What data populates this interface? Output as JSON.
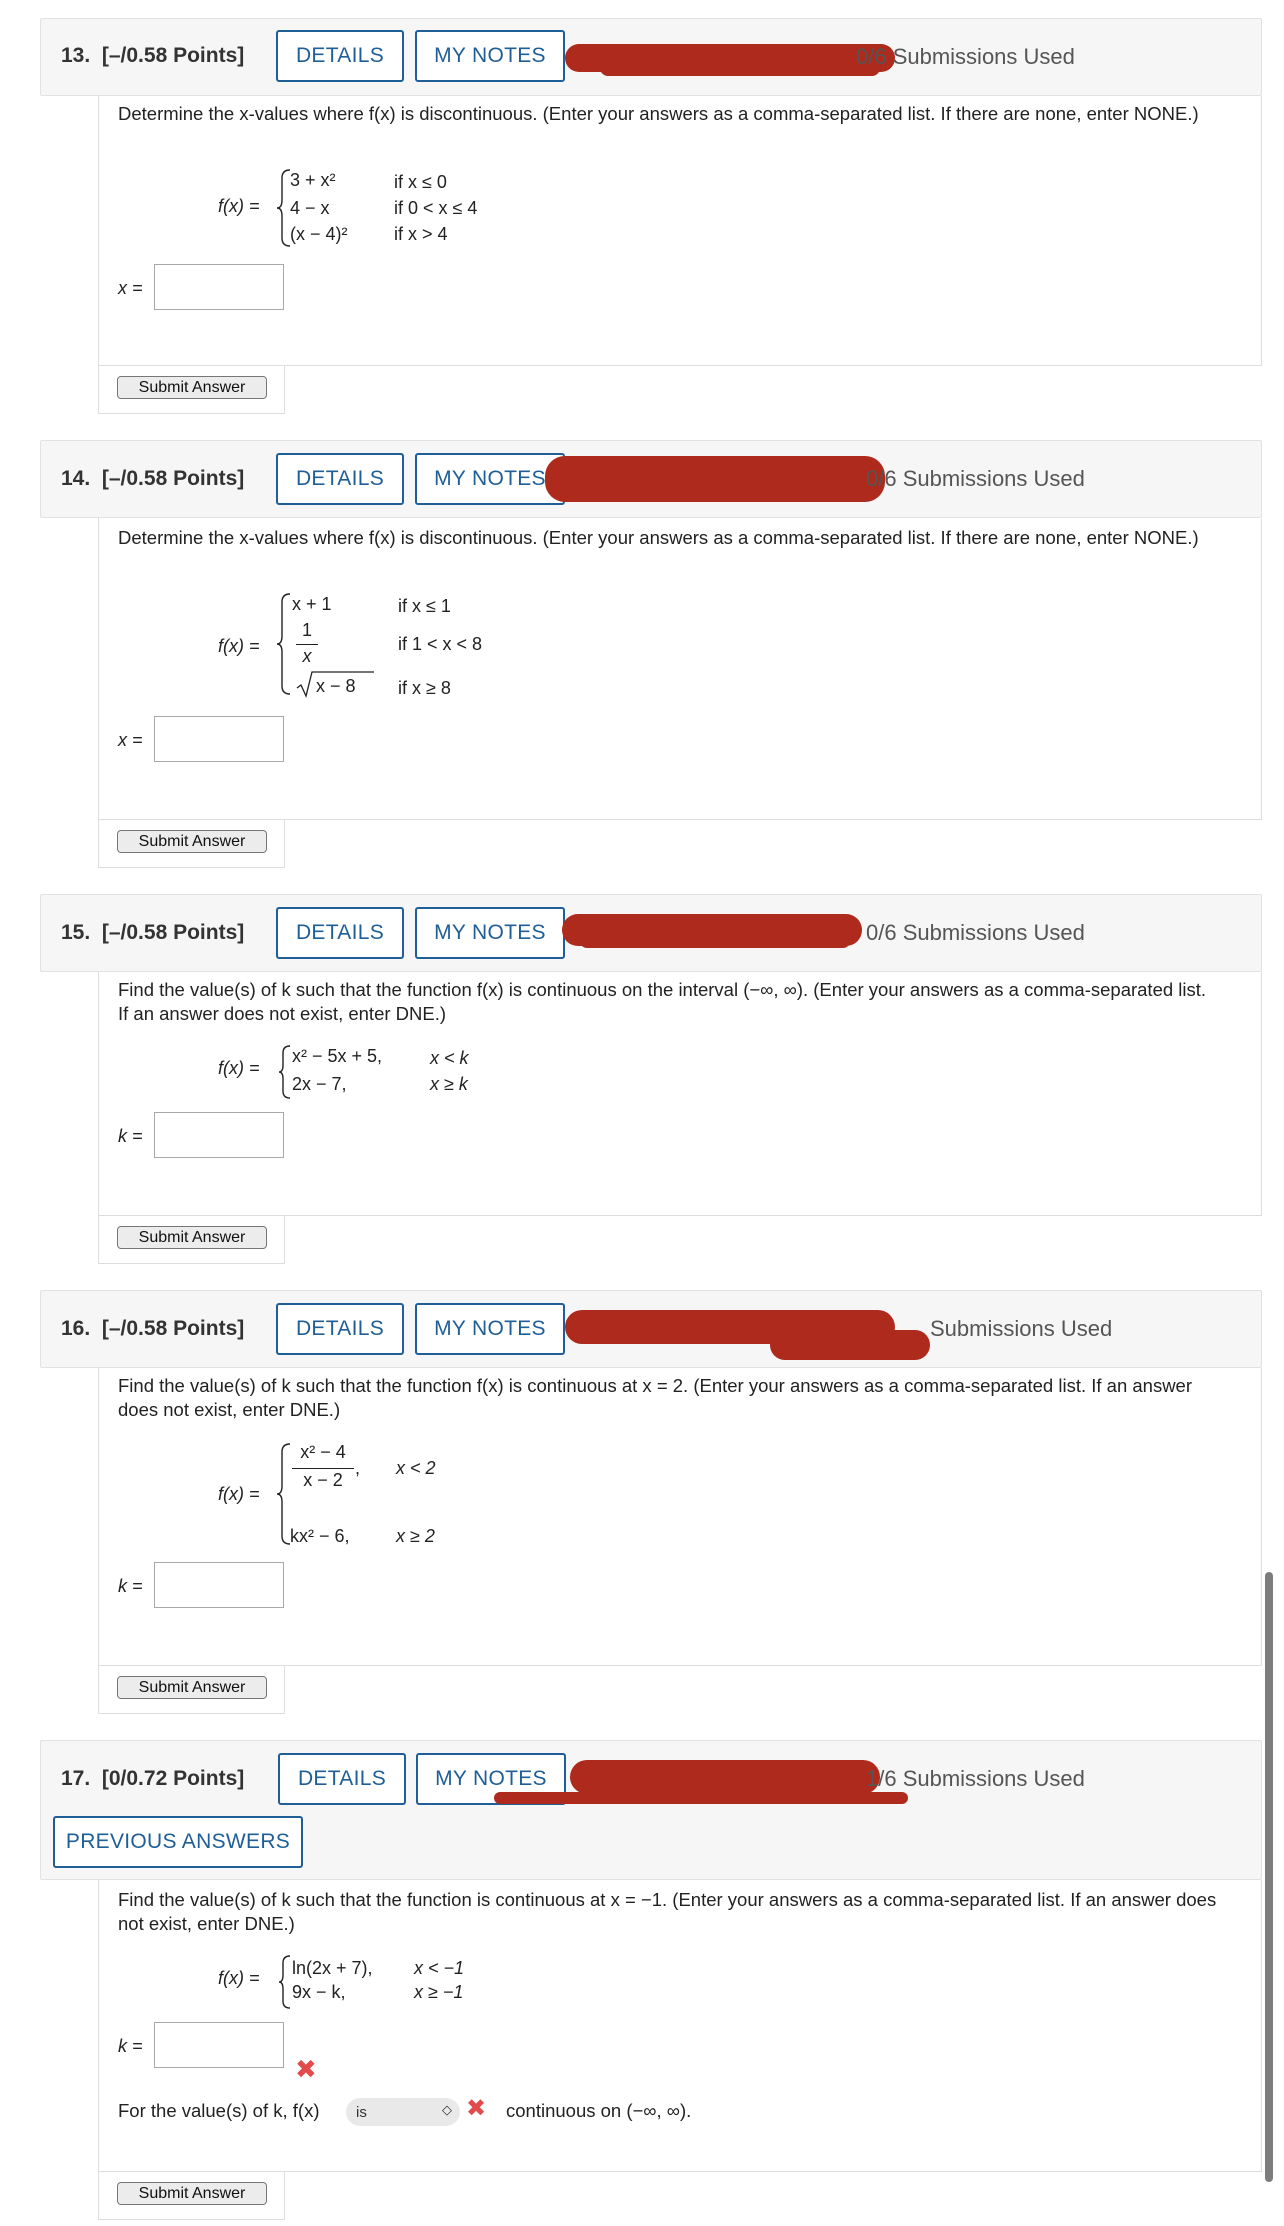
{
  "common": {
    "details": "DETAILS",
    "my_notes": "MY NOTES",
    "submit": "Submit Answer",
    "prompt_discontinuous": "Determine the x-values where f(x) is discontinuous. (Enter your answers as a comma-separated list. If there are none, enter NONE.)"
  },
  "q13": {
    "num": "13.",
    "points": "[–/0.58 Points]",
    "submissions": "0/6 Submissions Used",
    "lhs": "f(x) =",
    "pieces": [
      "3 + x²",
      "4 − x",
      "(x − 4)²"
    ],
    "conds": [
      "if x ≤ 0",
      "if 0 < x ≤ 4",
      "if x > 4"
    ],
    "ans_label": "x =",
    "ans_value": ""
  },
  "q14": {
    "num": "14.",
    "points": "[–/0.58 Points]",
    "submissions": "0/6 Submissions Used",
    "lhs": "f(x) =",
    "pieces": [
      "x + 1",
      "1",
      "x",
      "x − 8"
    ],
    "conds": [
      "if x ≤ 1",
      "if 1 < x < 8",
      "if x ≥ 8"
    ],
    "ans_label": "x =",
    "ans_value": ""
  },
  "q15": {
    "num": "15.",
    "points": "[–/0.58 Points]",
    "submissions": "0/6 Submissions Used",
    "prompt": "Find the value(s) of k such that the function f(x) is continuous on the interval (−∞, ∞). (Enter your answers as a comma-separated list. If an answer does not exist, enter DNE.)",
    "lhs": "f(x) =",
    "pieces": [
      "x² − 5x + 5,",
      "2x − 7,"
    ],
    "conds": [
      "x < k",
      "x ≥ k"
    ],
    "ans_label": "k =",
    "ans_value": ""
  },
  "q16": {
    "num": "16.",
    "points": "[–/0.58 Points]",
    "submissions": "Submissions Used",
    "prompt": "Find the value(s) of k such that the function f(x) is continuous at x = 2. (Enter your answers as a comma-separated list. If an answer does not exist, enter DNE.)",
    "lhs": "f(x) =",
    "pieces": [
      "x² − 4",
      "x − 2",
      ",",
      "kx² − 6,"
    ],
    "conds": [
      "x < 2",
      "x ≥ 2"
    ],
    "ans_label": "k =",
    "ans_value": ""
  },
  "q17": {
    "num": "17.",
    "points": "[0/0.72 Points]",
    "submissions": "1/6 Submissions Used",
    "previous_answers": "PREVIOUS ANSWERS",
    "prompt": "Find the value(s) of k such that the function is continuous at x = −1. (Enter your answers as a comma-separated list. If an answer does not exist, enter DNE.)",
    "lhs": "f(x) =",
    "pieces": [
      "ln(2x + 7),",
      "9x − k,"
    ],
    "conds": [
      "x < −1",
      "x ≥ −1"
    ],
    "ans_label": "k =",
    "ans_value": "",
    "followup_pre": "For the value(s) of k, f(x)",
    "select_value": "is",
    "followup_post": "continuous on (−∞, ∞)."
  },
  "colors": {
    "accent": "#1f5e96",
    "redaction": "#ad2a1c",
    "error": "#e24b4b",
    "header_bg": "#f6f6f6"
  }
}
